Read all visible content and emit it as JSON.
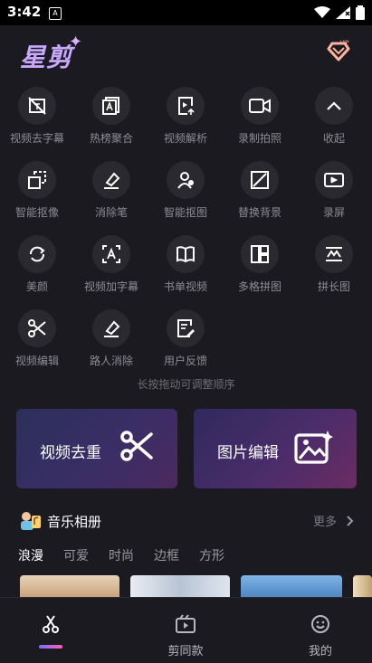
{
  "status_bar": {
    "time": "3:42",
    "notif_glyph": "A"
  },
  "header": {
    "logo_text": "星剪",
    "vip_label": "VIP"
  },
  "tools": [
    {
      "label": "视频去字幕",
      "icon": "remove-subtitle-icon"
    },
    {
      "label": "热榜聚合",
      "icon": "hot-list-icon"
    },
    {
      "label": "视频解析",
      "icon": "video-parse-icon"
    },
    {
      "label": "录制拍照",
      "icon": "camera-record-icon"
    },
    {
      "label": "收起",
      "icon": "chevron-up-icon"
    },
    {
      "label": "智能抠像",
      "icon": "smart-cutout-icon"
    },
    {
      "label": "消除笔",
      "icon": "eraser-icon"
    },
    {
      "label": "智能抠图",
      "icon": "smart-matting-icon"
    },
    {
      "label": "替换背景",
      "icon": "replace-background-icon"
    },
    {
      "label": "录屏",
      "icon": "screen-record-icon"
    },
    {
      "label": "美颜",
      "icon": "beauty-icon"
    },
    {
      "label": "视频加字幕",
      "icon": "add-subtitle-icon"
    },
    {
      "label": "书单视频",
      "icon": "book-video-icon"
    },
    {
      "label": "多格拼图",
      "icon": "grid-collage-icon"
    },
    {
      "label": "拼长图",
      "icon": "long-image-icon"
    },
    {
      "label": "视频编辑",
      "icon": "scissors-icon"
    },
    {
      "label": "路人消除",
      "icon": "passerby-remove-icon"
    },
    {
      "label": "用户反馈",
      "icon": "feedback-icon"
    }
  ],
  "hint": "长按拖动可调整顺序",
  "cards": {
    "video_dedup": "视频去重",
    "image_edit": "图片编辑"
  },
  "music_section": {
    "title": "音乐相册",
    "more": "更多"
  },
  "music_tabs": [
    "浪漫",
    "可爱",
    "时尚",
    "边框",
    "方形"
  ],
  "bottom_nav": {
    "edit_label": "",
    "templates_label": "剪同款",
    "profile_label": "我的"
  },
  "colors": {
    "background": "#1b1a20",
    "icon_circle": "#2a2930",
    "label": "#8d8c94",
    "accent_start": "#7b6cff",
    "accent_end": "#ff5fb0"
  }
}
